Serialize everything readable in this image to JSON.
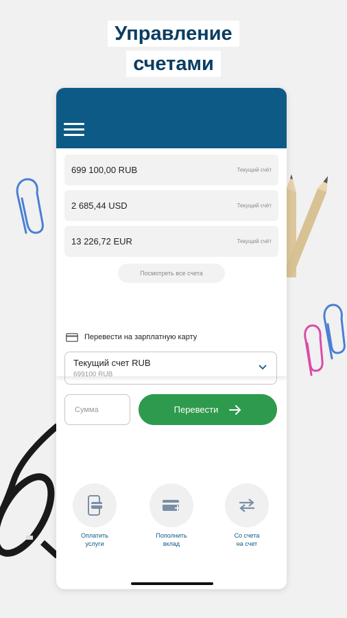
{
  "promo": {
    "title_line1": "Управление",
    "title_line2": "счетами"
  },
  "accounts": [
    {
      "amount": "699 100,00 RUB",
      "type": "Текущий счёт"
    },
    {
      "amount": "2 685,44 USD",
      "type": "Текущий счёт"
    },
    {
      "amount": "13 226,72 EUR",
      "type": "Текущий счёт"
    }
  ],
  "view_all_label": "Посмотреть все счета",
  "transfer": {
    "title": "Перевести на зарплатную карту",
    "select_label": "Текущий счет RUB",
    "select_sub": "699100 RUB",
    "amount_placeholder": "Сумма",
    "button_label": "Перевести"
  },
  "actions": [
    {
      "label": "Оплатить\nуслуги",
      "icon": "pay-services-icon"
    },
    {
      "label": "Пополнить\nвклад",
      "icon": "card-deposit-icon"
    },
    {
      "label": "Со счета\nна счет",
      "icon": "exchange-arrows-icon"
    }
  ],
  "colors": {
    "header": "#0e5a86",
    "accent_green": "#2e9a4d",
    "title_blue": "#0a3d62",
    "background": "#f1f1f1"
  }
}
